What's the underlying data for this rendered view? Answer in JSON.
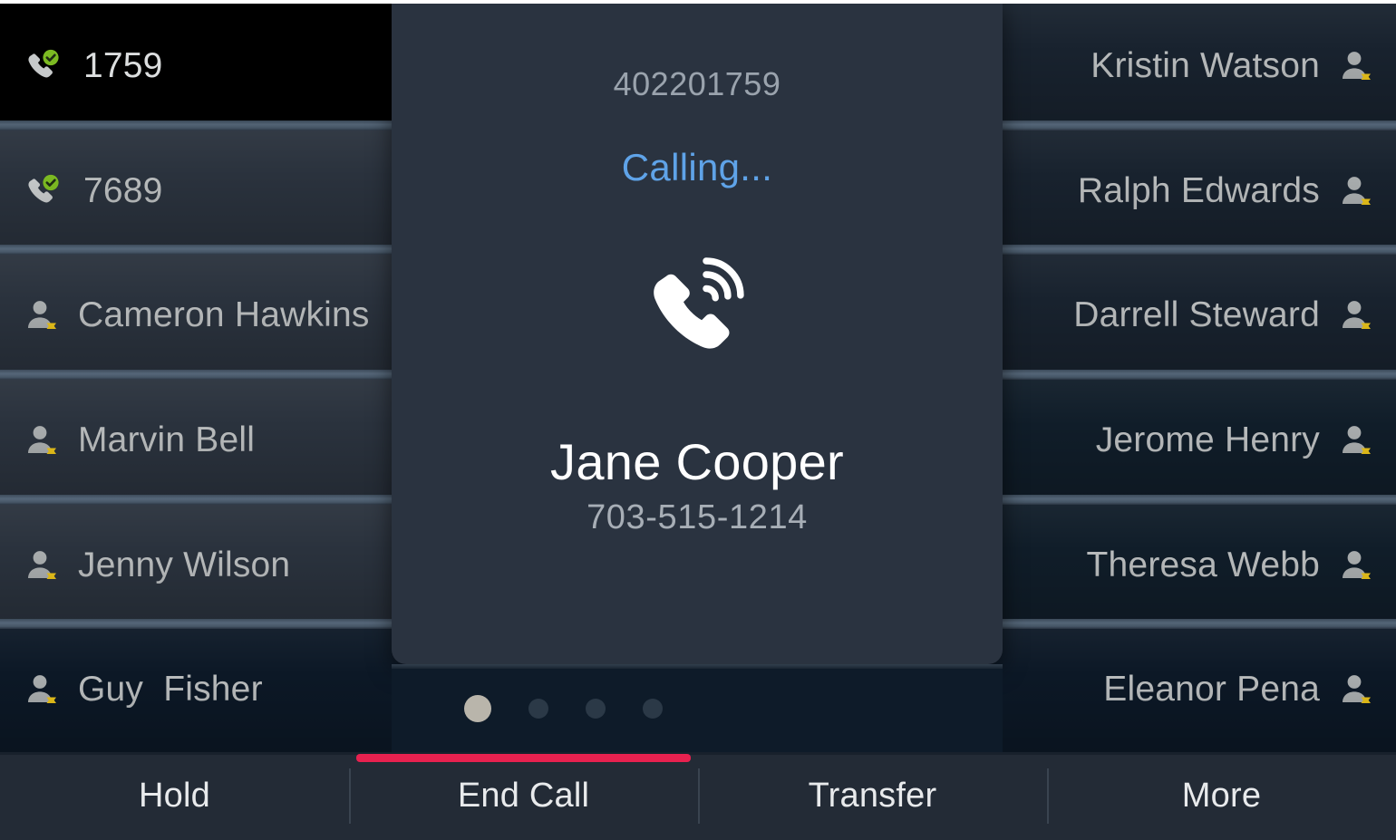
{
  "device": {
    "screen_title": "VoIP phone call screen"
  },
  "lines": [
    {
      "id": "line1",
      "label": "1759",
      "icon": "phone-available-icon",
      "state": "active",
      "column": "left"
    },
    {
      "id": "line2",
      "label": "7689",
      "icon": "phone-available-icon",
      "state": "idle",
      "column": "left"
    }
  ],
  "contacts_left": [
    {
      "label": "Cameron Hawkins",
      "icon": "contact-unavailable-icon"
    },
    {
      "label": "Marvin Bell",
      "icon": "contact-unavailable-icon"
    },
    {
      "label": "Jenny Wilson",
      "icon": "contact-unavailable-icon"
    },
    {
      "label": "Guy  Fisher",
      "icon": "contact-unavailable-icon"
    }
  ],
  "contacts_right": [
    {
      "label": "Kristin Watson",
      "icon": "contact-unavailable-icon"
    },
    {
      "label": "Ralph Edwards",
      "icon": "contact-unavailable-icon"
    },
    {
      "label": "Darrell Steward",
      "icon": "contact-unavailable-icon"
    },
    {
      "label": "Jerome Henry",
      "icon": "contact-unavailable-icon"
    },
    {
      "label": "Theresa Webb",
      "icon": "contact-unavailable-icon"
    },
    {
      "label": "Eleanor Pena",
      "icon": "contact-unavailable-icon"
    }
  ],
  "call_modal": {
    "extension": "402201759",
    "status": "Calling...",
    "status_color": "#5fa3e8",
    "icon": "ringing-phone-icon",
    "caller_name": "Jane Cooper",
    "caller_number": "703-515-1214"
  },
  "pager": {
    "total_pages": 4,
    "active_page": 1
  },
  "softkeys": [
    {
      "label": "Hold",
      "selected": false
    },
    {
      "label": "End Call",
      "selected": true,
      "accent": "#e8214f"
    },
    {
      "label": "Transfer",
      "selected": false
    },
    {
      "label": "More",
      "selected": false
    }
  ],
  "colors": {
    "row_bg": "#2a323d",
    "active_row_bg": "#000000",
    "modal_bg": "#2a3340",
    "accent_red": "#e8214f",
    "status_blue": "#5fa3e8",
    "presence_green": "#7cba22",
    "presence_gold": "#e9c21a",
    "text_primary": "#ffffff",
    "text_secondary": "#b9bcbd"
  }
}
